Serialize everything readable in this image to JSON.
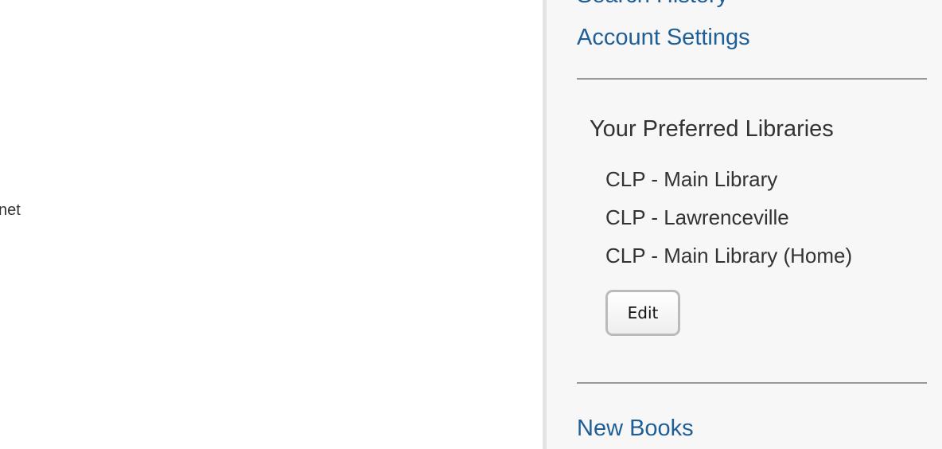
{
  "main": {
    "partial_text": "net"
  },
  "sidebar": {
    "links": {
      "search_history": "Search History",
      "account_settings": "Account Settings",
      "new_books": "New Books"
    },
    "preferred": {
      "heading": "Your Preferred Libraries",
      "libraries": [
        "CLP - Main Library",
        "CLP - Lawrenceville",
        "CLP - Main Library (Home)"
      ],
      "edit_label": "Edit"
    }
  }
}
